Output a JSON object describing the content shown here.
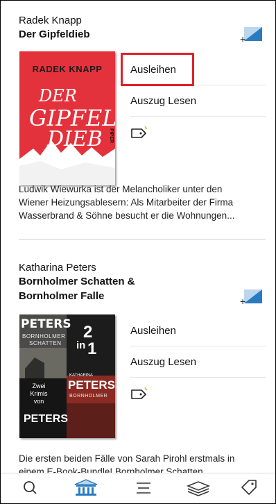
{
  "books": [
    {
      "author": "Radek Knapp",
      "title_lines": [
        "Der Gipfeldieb"
      ],
      "cover": {
        "author_text": "RADEK KNAPP",
        "title_text": [
          "DER",
          "GIPFEL",
          "DIEB"
        ],
        "publisher": "PIPER",
        "bg_color": "#e4323d"
      },
      "actions": {
        "borrow": "Ausleihen",
        "excerpt": "Auszug Lesen"
      },
      "description": [
        "Ludwik Wiewurka ist der Melancholiker unter den",
        "Wiener Heizungsablesern: Als Mitarbeiter der Firma",
        "Wasserbrand & Söhne besucht er die Wohnungen..."
      ]
    },
    {
      "author": "Katharina Peters",
      "title_lines": [
        "Bornholmer Schatten &",
        "Bornholmer Falle"
      ],
      "cover": {
        "name_top": "PETERS",
        "subtitle_top": [
          "BORNHOLMER",
          "SCHATTEN"
        ],
        "badge": [
          "2",
          "in",
          "1"
        ],
        "zwei": [
          "Zwei",
          "Krimis",
          "von"
        ],
        "name_small": "KATHARINA",
        "name_mid": "PETERS",
        "name_bottom": "PETERS",
        "subtitle_bottom": "BORNHOLMER"
      },
      "actions": {
        "borrow": "Ausleihen",
        "excerpt": "Auszug Lesen"
      },
      "description": [
        "Die ersten beiden Fälle von Sarah Pirohl erstmals in",
        "einem E-Book-Bundle! Bornholmer Schatten"
      ]
    }
  ],
  "tabbar": {
    "items": [
      "search-icon",
      "library-icon",
      "menu-icon",
      "shelf-icon",
      "tag-icon"
    ],
    "active": "library-icon"
  },
  "colors": {
    "accent_blue": "#2a7bc0",
    "highlight_red": "#e2202c"
  }
}
